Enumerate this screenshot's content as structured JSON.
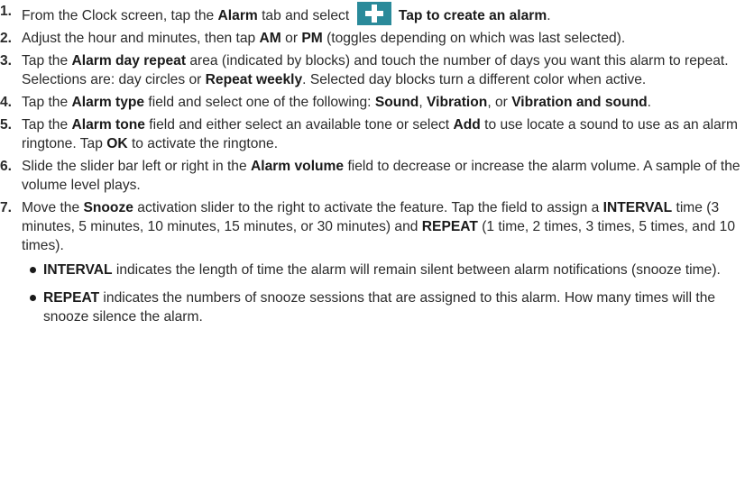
{
  "steps": [
    {
      "num": "1.",
      "parts": [
        "From the Clock screen, tap the ",
        "Alarm",
        " tab and select ",
        "Tap to create an alarm",
        "."
      ]
    },
    {
      "num": "2.",
      "parts": [
        "Adjust the hour and minutes, then tap ",
        "AM",
        " or ",
        "PM",
        " (toggles depending on which was last selected)."
      ]
    },
    {
      "num": "3.",
      "parts": [
        "Tap the ",
        "Alarm day repeat",
        " area (indicated by blocks) and touch the number of days you want this alarm to repeat. Selections are: day circles or ",
        "Repeat weekly",
        ". Selected day blocks turn a different color when active."
      ]
    },
    {
      "num": "4.",
      "parts": [
        "Tap the ",
        "Alarm type",
        " field and select one of the following: ",
        "Sound",
        ", ",
        "Vibration",
        ", or ",
        "Vibration and sound",
        "."
      ]
    },
    {
      "num": "5.",
      "parts": [
        "Tap the ",
        "Alarm tone",
        " field and either select an available tone or select ",
        "Add",
        " to use locate a sound to use as an alarm ringtone. Tap ",
        "OK",
        " to activate the ringtone."
      ]
    },
    {
      "num": "6.",
      "parts": [
        "Slide the slider bar left or right in the ",
        "Alarm volume",
        " field to decrease or increase the alarm volume. A sample of the volume level plays."
      ]
    },
    {
      "num": "7.",
      "parts": [
        "Move the ",
        "Snooze",
        " activation slider to the right to activate the feature. Tap the field to assign a ",
        "INTERVAL",
        " time (3 minutes, 5 minutes, 10 minutes, 15 minutes, or 30 minutes) and ",
        "REPEAT",
        " (1 time, 2 times, 3 times, 5 times, and 10 times)."
      ]
    }
  ],
  "bullets": [
    {
      "parts": [
        "INTERVAL",
        " indicates the length of time the alarm will remain silent between alarm notifications (snooze time)."
      ]
    },
    {
      "parts": [
        "REPEAT",
        " indicates the numbers of snooze sessions that are assigned to this alarm. How many times will the snooze silence the alarm."
      ]
    }
  ],
  "icons": {
    "create_alarm": "plus-icon",
    "create_alarm_color": "#2a8a9a"
  }
}
